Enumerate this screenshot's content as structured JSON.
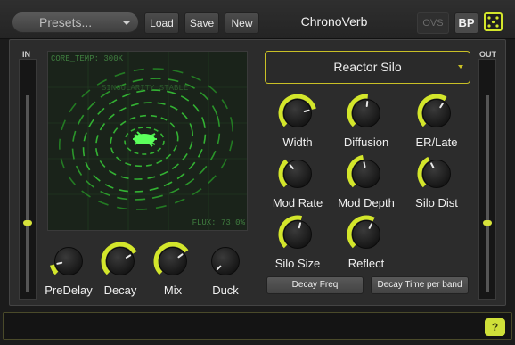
{
  "toolbar": {
    "preset_label": "Presets...",
    "load_label": "Load",
    "save_label": "Save",
    "new_label": "New",
    "title": "ChronoVerb",
    "ovs_label": "OVS",
    "bp_label": "BP"
  },
  "meters": {
    "in_label": "IN",
    "out_label": "OUT",
    "in_level": 0.35,
    "out_level": 0.35
  },
  "visualizer": {
    "core_temp": "CORE_TEMP: 300K",
    "flux": "FLUX: 73.0%",
    "faint_text": "SINGULARITY STABLE"
  },
  "reverb_type": {
    "selected": "Reactor Silo"
  },
  "knobs_left": [
    {
      "label": "PreDelay",
      "value": 0.12
    },
    {
      "label": "Decay",
      "value": 0.72
    },
    {
      "label": "Mix",
      "value": 0.7
    },
    {
      "label": "Duck",
      "value": 0.0
    }
  ],
  "knobs_right": [
    {
      "label": "Width",
      "value": 0.78
    },
    {
      "label": "Diffusion",
      "value": 0.52
    },
    {
      "label": "ER/Late",
      "value": 0.62
    },
    {
      "label": "Mod Rate",
      "value": 0.35
    },
    {
      "label": "Mod Depth",
      "value": 0.46
    },
    {
      "label": "Silo Dist",
      "value": 0.4
    },
    {
      "label": "Silo Size",
      "value": 0.55
    },
    {
      "label": "Reflect",
      "value": 0.6
    }
  ],
  "buttons": {
    "decay_freq": "Decay Freq",
    "decay_time_band": "Decay Time per band"
  },
  "help_label": "?",
  "colors": {
    "accent": "#d3e62b",
    "viz_green": "#3ad13a",
    "panel": "#2c2c2c"
  }
}
